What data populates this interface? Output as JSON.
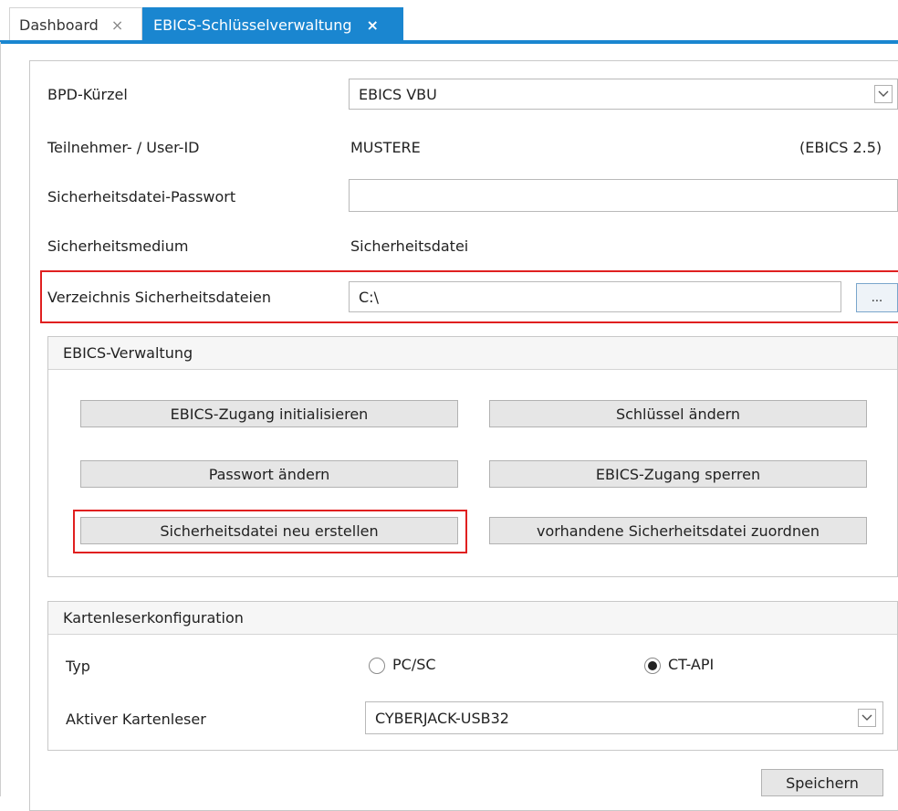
{
  "tabs": [
    {
      "label": "Dashboard",
      "close": "×"
    },
    {
      "label": "EBICS-Schlüsselverwaltung",
      "close": "×"
    }
  ],
  "form": {
    "bpd_label": "BPD-Kürzel",
    "bpd_value": "EBICS VBU",
    "user_label": "Teilnehmer- / User-ID",
    "user_value": "MUSTERE",
    "ebics_version": "(EBICS 2.5)",
    "password_label": "Sicherheitsdatei-Passwort",
    "password_value": "",
    "medium_label": "Sicherheitsmedium",
    "medium_value": "Sicherheitsdatei",
    "dir_label": "Verzeichnis Sicherheitsdateien",
    "dir_value": "C:\\",
    "browse_label": "..."
  },
  "ebics_admin": {
    "title": "EBICS-Verwaltung",
    "btn_init": "EBICS-Zugang initialisieren",
    "btn_change_key": "Schlüssel ändern",
    "btn_change_password": "Passwort ändern",
    "btn_lock": "EBICS-Zugang sperren",
    "btn_new_file": "Sicherheitsdatei neu erstellen",
    "btn_assign_file": "vorhandene Sicherheitsdatei zuordnen"
  },
  "card_reader": {
    "title": "Kartenleserkonfiguration",
    "type_label": "Typ",
    "option_pcsc": "PC/SC",
    "option_ctapi": "CT-API",
    "selected": "CT-API",
    "active_label": "Aktiver Kartenleser",
    "active_value": "CYBERJACK-USB32"
  },
  "save_label": "Speichern",
  "colors": {
    "accent": "#1a86d0",
    "highlight": "#e02020"
  },
  "icons": [
    "close-icon",
    "chevron-down-icon"
  ]
}
